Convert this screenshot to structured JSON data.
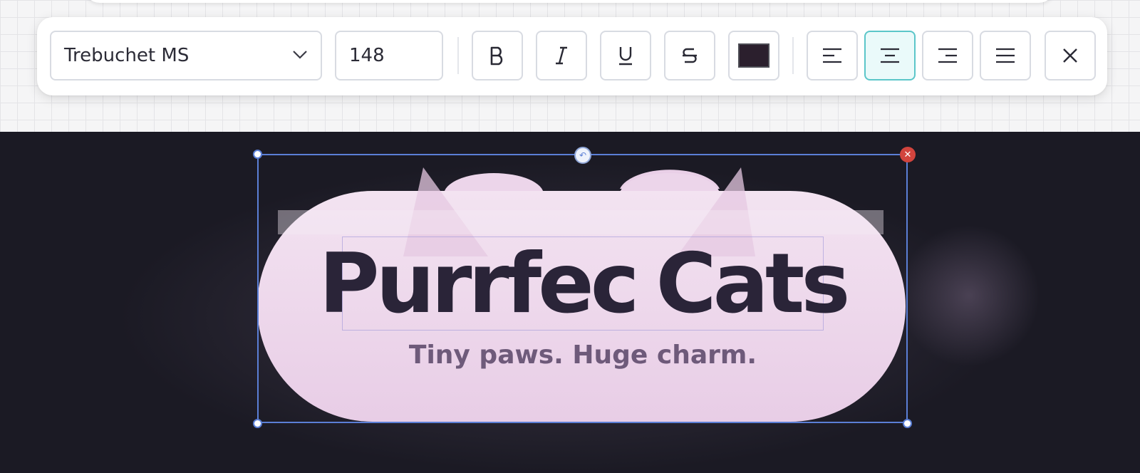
{
  "toolbar": {
    "font_family": "Trebuchet MS",
    "font_size": "148",
    "text_color": "#2b1f2d",
    "active_align": "center",
    "buttons": {
      "bold": "bold-icon",
      "italic": "italic-icon",
      "underline": "underline-icon",
      "strikethrough": "strikethrough-icon",
      "align_left": "align-left-icon",
      "align_center": "align-center-icon",
      "align_right": "align-right-icon",
      "justify": "align-justify-icon",
      "close": "close-icon"
    }
  },
  "canvas": {
    "title_part1": "Purrfec",
    "title_part2": "Cats",
    "subtitle": "Tiny paws. Huge charm.",
    "colors": {
      "background": "#1b1a24",
      "shape_fill": "#ecd5ea",
      "title": "#2a2438",
      "subtitle": "#6e5a7a",
      "selection": "#5b7fd6",
      "delete": "#d2443d"
    }
  }
}
